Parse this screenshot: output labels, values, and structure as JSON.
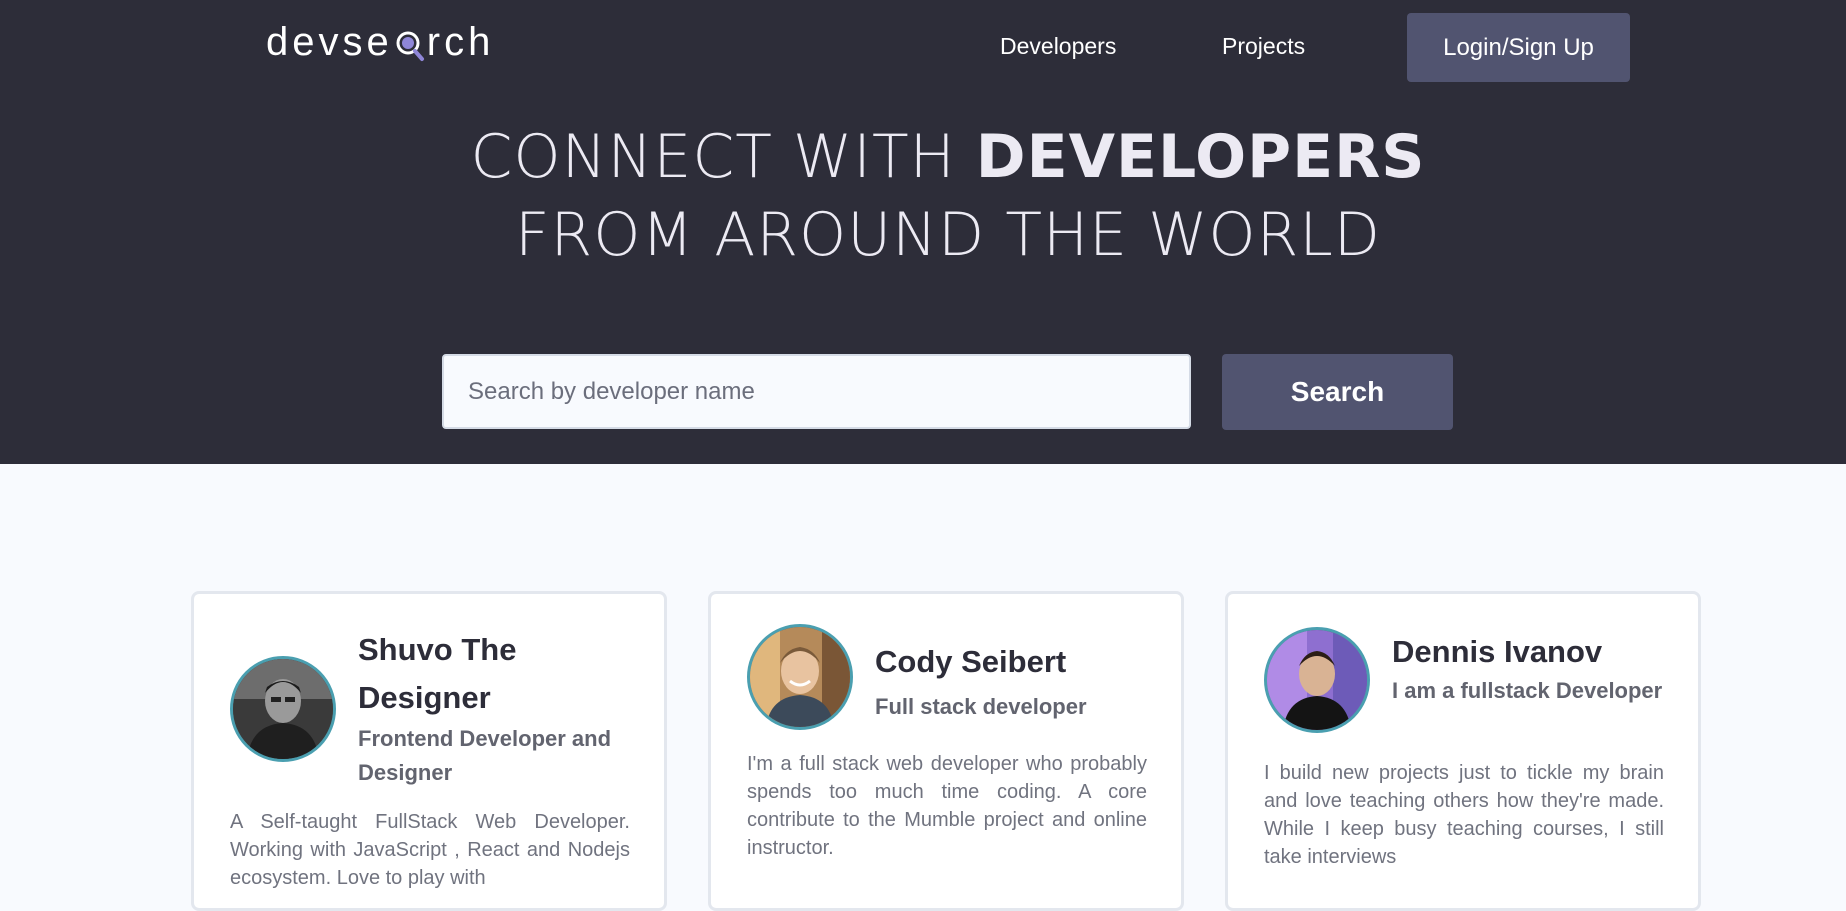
{
  "header": {
    "logo_text_before": "devse",
    "logo_text_after": "rch",
    "nav": {
      "developers": "Developers",
      "projects": "Projects",
      "login": "Login/Sign Up"
    }
  },
  "hero": {
    "headline_prefix": "CONNECT WITH ",
    "headline_bold": "DEVELOPERS",
    "headline_line2": "FROM AROUND THE WORLD",
    "search": {
      "placeholder": "Search by developer name",
      "value": "",
      "button_label": "Search"
    }
  },
  "developers": [
    {
      "name": "Shuvo The Designer",
      "title": "Frontend Developer and Designer",
      "bio": "A Self-taught FullStack Web Developer. Working with JavaScript , React and Nodejs ecosystem. Love to play with"
    },
    {
      "name": "Cody Seibert",
      "title": "Full stack developer",
      "bio": "I'm a full stack web developer who probably spends too much time coding. A core contribute to the Mumble project and online instructor."
    },
    {
      "name": "Dennis Ivanov",
      "title": "I am a fullstack Developer",
      "bio": "I build new projects just to tickle my brain and love teaching others how they're made. While I keep busy teaching courses, I still take interviews"
    }
  ],
  "colors": {
    "header_bg": "#2d2d39",
    "accent_button": "#515470",
    "page_bg": "#f8fafe",
    "avatar_ring": "#4a9fb0",
    "logo_lens": "#8f86d8"
  }
}
